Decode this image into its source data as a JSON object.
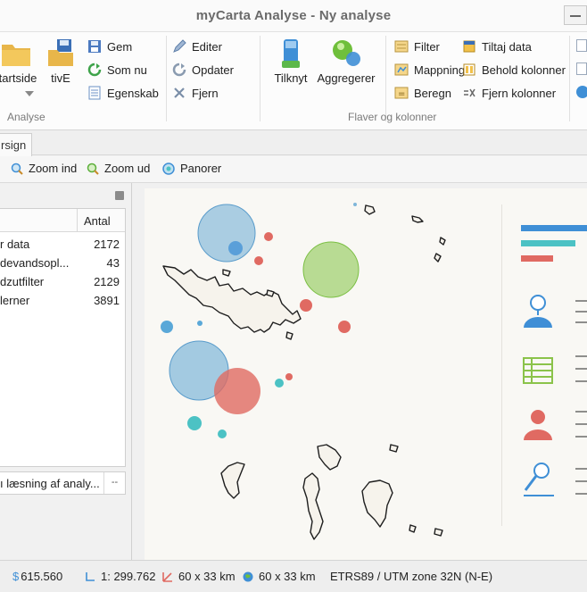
{
  "window": {
    "title": "myCarta Analyse - Ny analyse"
  },
  "ribbon": {
    "analyse_group": {
      "label": "Analyse",
      "startside_label": "tartside",
      "tive_label": "tivE",
      "gem_label": "Gem",
      "som_nu_label": "Som nu",
      "egenskab_label": "Egenskab",
      "editer_label": "Editer",
      "opdater_label": "Opdater",
      "fjern_label": "Fjern"
    },
    "flaver_group": {
      "label": "Flaver og kolonner",
      "tilknyt_label": "Tilknyt",
      "aggregerer_label": "Aggregerer",
      "filter_label": "Filter",
      "mappning_label": "Mappning",
      "beregn_label": "Beregn",
      "tiltaj_label": "Tiltaj data",
      "behold_label": "Behold kolonner",
      "fjern_kolonner_label": "Fjern kolonner"
    }
  },
  "tabs": {
    "active_label": "rsign"
  },
  "toolbar": {
    "zoom_in_label": "Zoom ind",
    "zoom_out_label": "Zoom ud",
    "pan_label": "Panorer"
  },
  "left_panel": {
    "header_col2": "Antal",
    "rows": [
      {
        "name": "r data",
        "count": "2172"
      },
      {
        "name": "devandsopl...",
        "count": "43"
      },
      {
        "name": "dzutfilter",
        "count": "2129"
      },
      {
        "name": "lerner",
        "count": "3891"
      }
    ],
    "combo_text": "ı læsning af analy...",
    "combo_button": "--"
  },
  "status": {
    "cost": "615.560",
    "scale": "1: 299.762",
    "extent_1": "60 x 33 km",
    "extent_2": "60 x 33 km",
    "crs": "ETRS89 / UTM zone 32N (N-E)"
  },
  "colors": {
    "blue": "#7fb6d9",
    "green": "#9ccf6a",
    "red": "#e06a62",
    "teal": "#4cc2c4"
  }
}
